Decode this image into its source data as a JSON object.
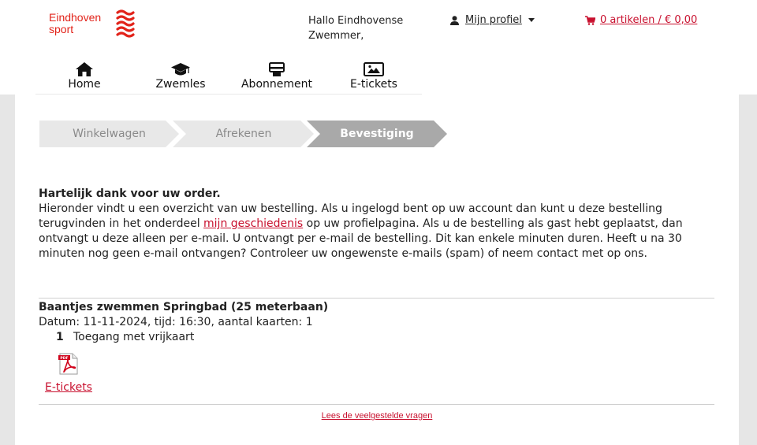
{
  "logo": {
    "line1": "Eindhoven",
    "line2": "sport",
    "icon": "eindhoven-waves-logo-icon"
  },
  "header": {
    "greeting": "Hallo Eindhovense Zwemmer,",
    "profile_label": "Mijn profiel",
    "cart_label": "0 artikelen / € 0,00"
  },
  "nav": {
    "items": [
      {
        "label": "Home",
        "icon": "home-icon"
      },
      {
        "label": "Zwemles",
        "icon": "graduation-cap-icon"
      },
      {
        "label": "Abonnement",
        "icon": "card-icon"
      },
      {
        "label": "E-tickets",
        "icon": "image-ticket-icon"
      }
    ]
  },
  "steps": {
    "items": [
      "Winkelwagen",
      "Afrekenen",
      "Bevestiging"
    ],
    "active_index": 2
  },
  "thanks": {
    "title": "Hartelijk dank voor uw order.",
    "text_before_link": "Hieronder vindt u een overzicht van uw bestelling. Als u ingelogd bent op uw account dan kunt u deze bestelling terugvinden in het onderdeel ",
    "link": "mijn geschiedenis",
    "text_after_link": " op uw profielpagina. Als u de bestelling als gast hebt geplaatst, dan ontvangt u deze alleen per e-mail. U ontvangt per e-mail de bestelling. Dit kan enkele minuten duren. Heeft u na 30 minuten nog geen e-mail ontvangen? Controleer uw ongewenste e-mails (spam) of neem contact met op ons."
  },
  "order": {
    "title": "Baantjes zwemmen Springbad (25 meterbaan)",
    "details": "Datum: 11-11-2024, tijd: 16:30, aantal kaarten: 1",
    "lines": [
      {
        "qty": "1",
        "description": "Toegang met vrijkaart"
      }
    ],
    "eticket_label": "E-tickets",
    "eticket_icon": "pdf-file-icon"
  },
  "footer": {
    "faq_link": "Lees de veelgestelde vragen"
  },
  "colors": {
    "brand_red": "#e2231a",
    "link_red": "#c8102e",
    "step_inactive": "#e8e8e8",
    "step_active": "#a9a9a9"
  }
}
